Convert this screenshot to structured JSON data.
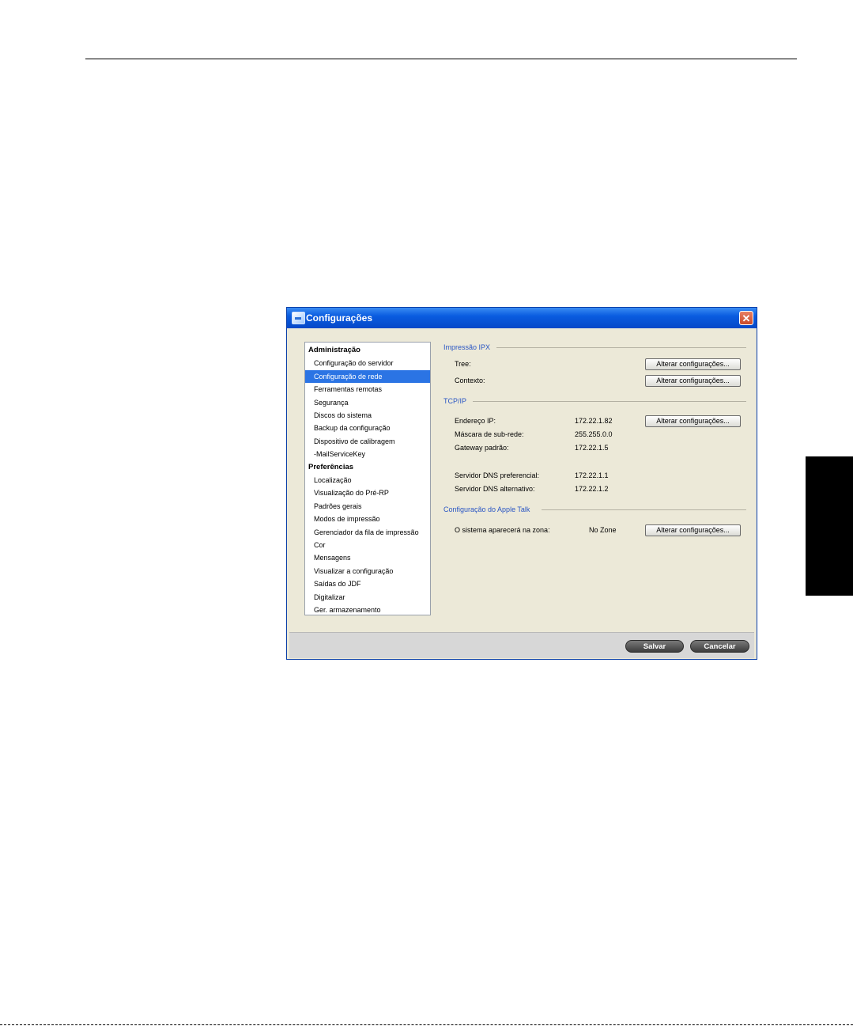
{
  "window": {
    "title": "Configurações",
    "close_glyph": "✕"
  },
  "sidebar": {
    "sections": [
      {
        "header": "Administração",
        "items": [
          "Configuração do servidor",
          "Configuração de rede",
          "Ferramentas remotas",
          "Segurança",
          "Discos do sistema",
          "Backup da configuração",
          "Dispositivo de calibragem",
          "-MailServiceKey"
        ]
      },
      {
        "header": "Preferências",
        "items": [
          "Localização",
          "Visualização do Pré-RP",
          "Padrões gerais",
          "Modos de impressão",
          "Gerenciador da fila de impressão",
          "Cor",
          "Mensagens",
          "Visualizar a configuração",
          "Saídas do JDF",
          "Digitalizar",
          "Ger. armazenamento"
        ]
      }
    ],
    "selected_item": "Configuração de rede"
  },
  "panel": {
    "ipx": {
      "title": "Impressão IPX",
      "tree_label": "Tree:",
      "context_label": "Contexto:"
    },
    "tcpip": {
      "title": "TCP/IP",
      "ip_label": "Endereço IP:",
      "ip_value": "172.22.1.82",
      "mask_label": "Máscara de sub-rede:",
      "mask_value": "255.255.0.0",
      "gateway_label": "Gateway padrão:",
      "gateway_value": "172.22.1.5",
      "dns1_label": "Servidor DNS preferencial:",
      "dns1_value": "172.22.1.1",
      "dns2_label": "Servidor DNS alternativo:",
      "dns2_value": "172.22.1.2"
    },
    "appletalk": {
      "title": "Configuração do Apple Talk",
      "zone_label": "O sistema aparecerá na zona:",
      "zone_value": "No Zone"
    },
    "change_button_label": "Alterar configurações..."
  },
  "footer": {
    "save_label": "Salvar",
    "cancel_label": "Cancelar"
  },
  "colors": {
    "titlebar": "#0a5ce0",
    "selection": "#2b74e4",
    "group_title": "#2a56c4"
  },
  "icons": {
    "app": "app-icon",
    "close": "close-icon"
  }
}
